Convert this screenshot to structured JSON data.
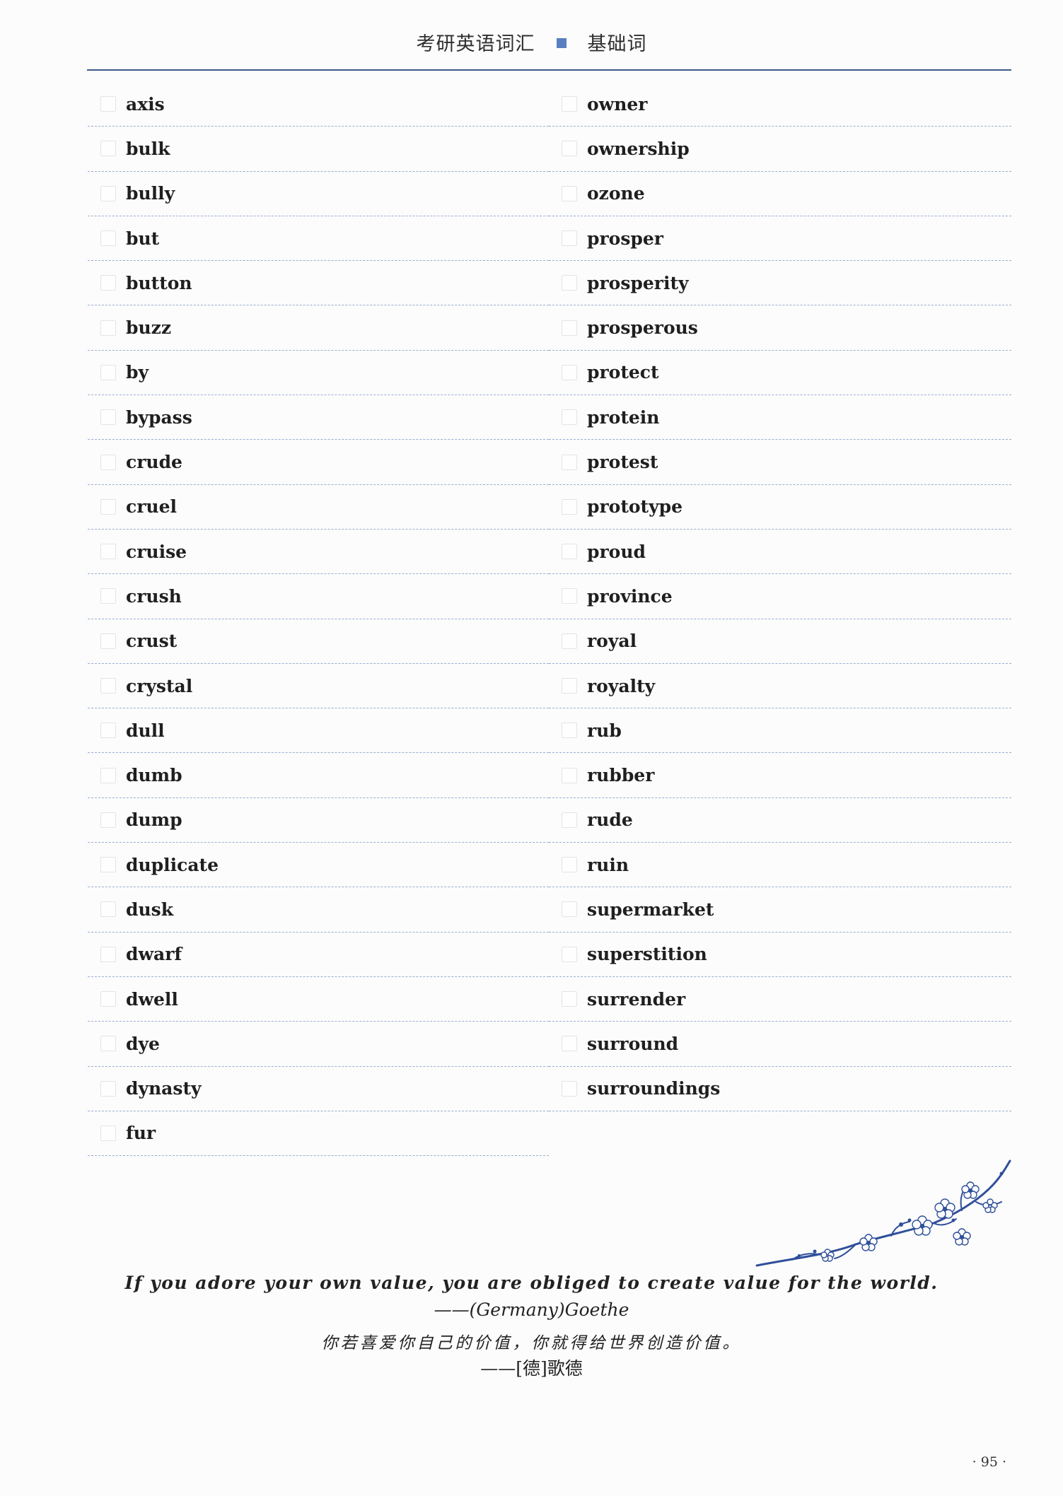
{
  "header": {
    "title_left": "考研英语词汇",
    "title_right": "基础词"
  },
  "vocab": {
    "left": [
      "axis",
      "bulk",
      "bully",
      "but",
      "button",
      "buzz",
      "by",
      "bypass",
      "crude",
      "cruel",
      "cruise",
      "crush",
      "crust",
      "crystal",
      "dull",
      "dumb",
      "dump",
      "duplicate",
      "dusk",
      "dwarf",
      "dwell",
      "dye",
      "dynasty",
      "fur"
    ],
    "right": [
      "owner",
      "ownership",
      "ozone",
      "prosper",
      "prosperity",
      "prosperous",
      "protect",
      "protein",
      "protest",
      "prototype",
      "proud",
      "province",
      "royal",
      "royalty",
      "rub",
      "rubber",
      "rude",
      "ruin",
      "supermarket",
      "superstition",
      "surrender",
      "surround",
      "surroundings"
    ]
  },
  "quote": {
    "english": "If you adore your own value, you are obliged to create value for the world.",
    "author_en": "——(Germany)Goethe",
    "chinese": "你若喜爱你自己的价值，你就得给世界创造价值。",
    "author_cn": "——[德]歌德"
  },
  "page": {
    "number": "· 95 ·"
  },
  "colors": {
    "accent": "#5a7fc0",
    "rule": "#3d5a8a",
    "branch": "#2f4f9a"
  }
}
